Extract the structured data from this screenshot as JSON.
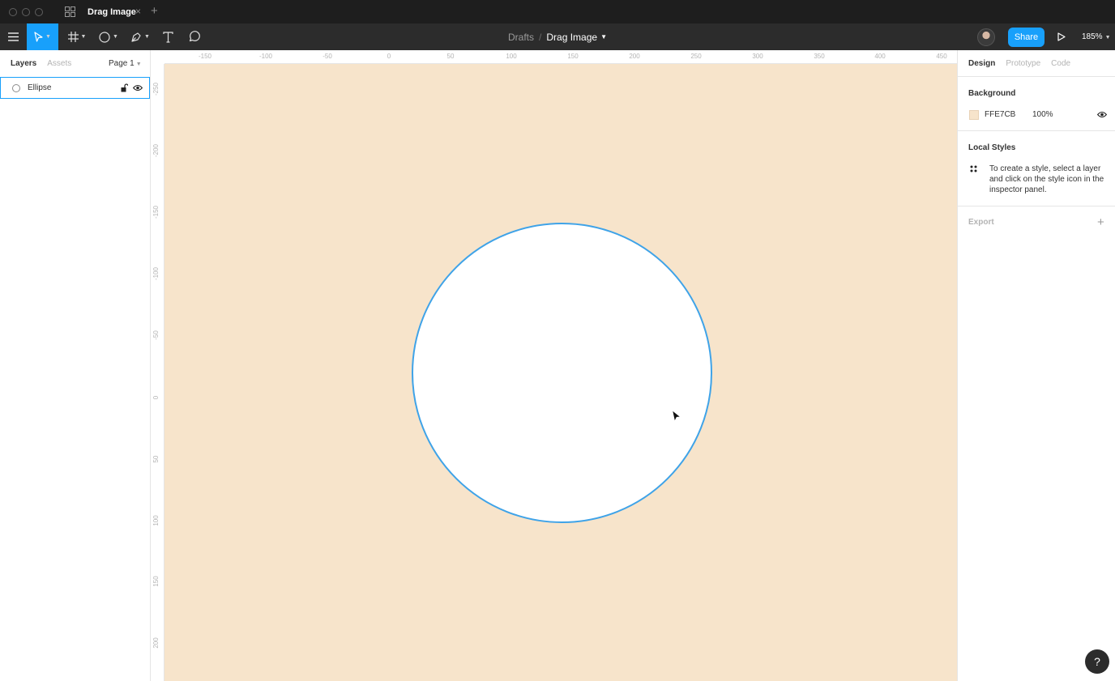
{
  "window": {
    "tab_title": "Drag Image",
    "tab_close_glyph": "×",
    "new_tab_glyph": "+"
  },
  "toolbar": {
    "breadcrumb_root": "Drafts",
    "breadcrumb_separator": "/",
    "file_name": "Drag Image",
    "share_label": "Share",
    "zoom_level": "185%"
  },
  "left_panel": {
    "tab_layers": "Layers",
    "tab_assets": "Assets",
    "page_selector": "Page 1",
    "layers": [
      {
        "name": "Ellipse",
        "icon": "ellipse-layer-icon"
      }
    ]
  },
  "rulers": {
    "horizontal": [
      "-150",
      "-100",
      "-50",
      "0",
      "50",
      "100",
      "150",
      "200",
      "250",
      "300",
      "350",
      "400",
      "450"
    ],
    "vertical": [
      "-250",
      "-200",
      "-150",
      "-100",
      "-50",
      "0",
      "50",
      "100",
      "150",
      "200"
    ]
  },
  "right_panel": {
    "tab_design": "Design",
    "tab_prototype": "Prototype",
    "tab_code": "Code",
    "background_title": "Background",
    "background_hex": "FFE7CB",
    "background_opacity": "100%",
    "local_styles_title": "Local Styles",
    "local_styles_hint": "To create a style, select a layer and click on the style icon in the inspector panel.",
    "export_title": "Export",
    "export_add_glyph": "+"
  },
  "help_label": "?",
  "colors": {
    "canvas_background": "#f7e4cb",
    "accent": "#18a0fb",
    "ellipse_stroke": "#3fa3e8",
    "ellipse_fill": "#ffffff",
    "toolbar": "#2c2c2c",
    "titlebar": "#1e1e1e"
  }
}
